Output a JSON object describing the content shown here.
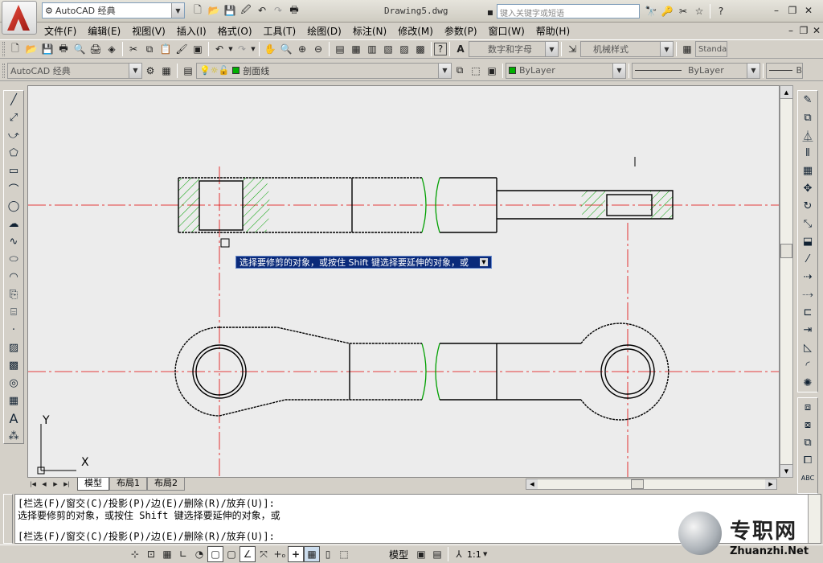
{
  "titlebar": {
    "workspace": "AutoCAD 经典",
    "document": "Drawing5.dwg",
    "search_placeholder": "键入关键字或短语"
  },
  "menu": [
    "文件(F)",
    "编辑(E)",
    "视图(V)",
    "插入(I)",
    "格式(O)",
    "工具(T)",
    "绘图(D)",
    "标注(N)",
    "修改(M)",
    "参数(P)",
    "窗口(W)",
    "帮助(H)"
  ],
  "toolbar": {
    "text_style": "数字和字母",
    "dim_style": "机械样式",
    "table_style": "Standa"
  },
  "layers": {
    "workspace": "AutoCAD 经典",
    "current_layer": "剖面线",
    "color": "ByLayer",
    "linetype": "ByLayer",
    "lineweight": "B"
  },
  "canvas": {
    "tooltip": "选择要修剪的对象，或按住 Shift 键选择要延伸的对象，或",
    "ucs_y": "Y",
    "ucs_x": "X"
  },
  "tabs": [
    "模型",
    "布局1",
    "布局2"
  ],
  "command": {
    "line1": "[栏选(F)/窗交(C)/投影(P)/边(E)/删除(R)/放弃(U)]:",
    "line2": "选择要修剪的对象，或按住 Shift 键选择要延伸的对象，或",
    "line3": "[栏选(F)/窗交(C)/投影(P)/边(E)/删除(R)/放弃(U)]:"
  },
  "status": {
    "model": "模型",
    "scale": "1:1"
  },
  "watermark": {
    "brand": "专职网",
    "url": "Zhuanzhi.Net"
  }
}
